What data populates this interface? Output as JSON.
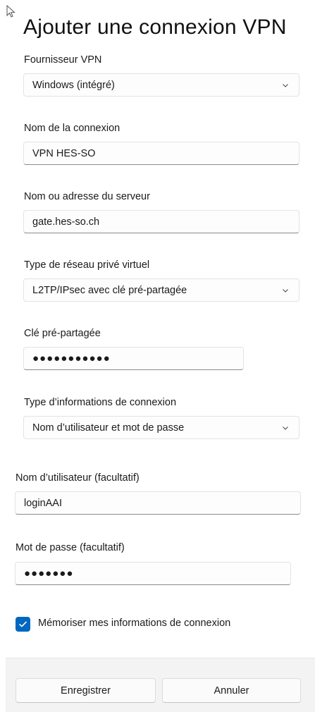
{
  "dialog": {
    "title": "Ajouter une connexion VPN"
  },
  "fields": {
    "provider": {
      "label": "Fournisseur VPN",
      "value": "Windows (intégré)"
    },
    "connection_name": {
      "label": "Nom de la connexion",
      "value": "VPN HES-SO"
    },
    "server": {
      "label": "Nom ou adresse du serveur",
      "value": "gate.hes-so.ch"
    },
    "vpn_type": {
      "label": "Type de réseau privé virtuel",
      "value": "L2TP/IPsec avec clé pré-partagée"
    },
    "psk": {
      "label": "Clé pré-partagée",
      "value": "●●●●●●●●●●●"
    },
    "signin_type": {
      "label": "Type d’informations de connexion",
      "value": "Nom d’utilisateur et mot de passe"
    },
    "username": {
      "label": "Nom d’utilisateur (facultatif)",
      "value": "loginAAI"
    },
    "password": {
      "label": "Mot de passe (facultatif)",
      "value": "●●●●●●●"
    }
  },
  "remember": {
    "label": "Mémoriser mes informations de connexion",
    "checked": true
  },
  "buttons": {
    "save": "Enregistrer",
    "cancel": "Annuler"
  },
  "colors": {
    "accent": "#0067c0"
  }
}
